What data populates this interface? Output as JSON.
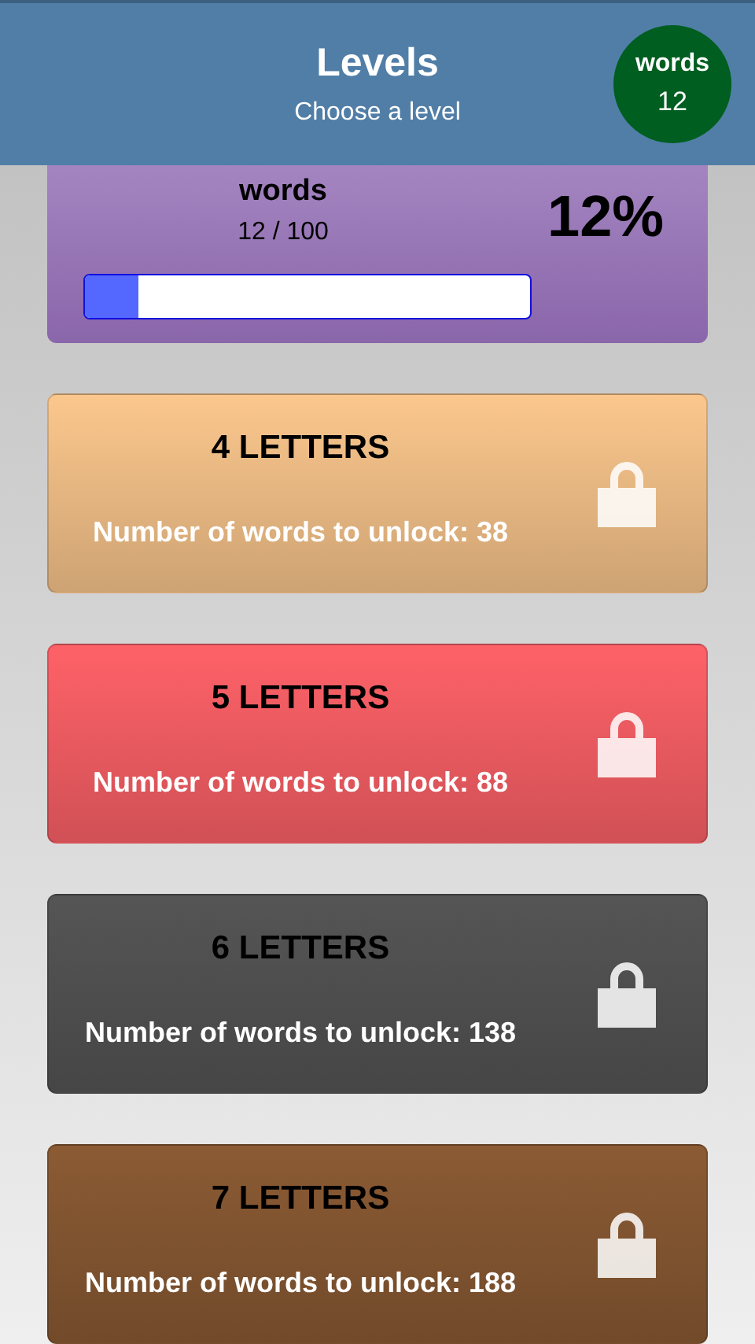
{
  "header": {
    "title": "Levels",
    "subtitle": "Choose a level",
    "badge_label": "words",
    "badge_count": "12"
  },
  "progress_card": {
    "label": "words",
    "count": "12 / 100",
    "percent": "12%",
    "level": 0.12
  },
  "levels": [
    {
      "title": "4 LETTERS",
      "unlock_text": "Number of words to unlock: 38",
      "locked": true,
      "color": "#fbc78d"
    },
    {
      "title": "5 LETTERS",
      "unlock_text": "Number of words to unlock: 88",
      "locked": true,
      "color": "#fe6268"
    },
    {
      "title": "6 LETTERS",
      "unlock_text": "Number of words to unlock: 138",
      "locked": true,
      "color": "#555555"
    },
    {
      "title": "7 LETTERS",
      "unlock_text": "Number of words to unlock: 188",
      "locked": true,
      "color": "#8b5b34"
    }
  ]
}
